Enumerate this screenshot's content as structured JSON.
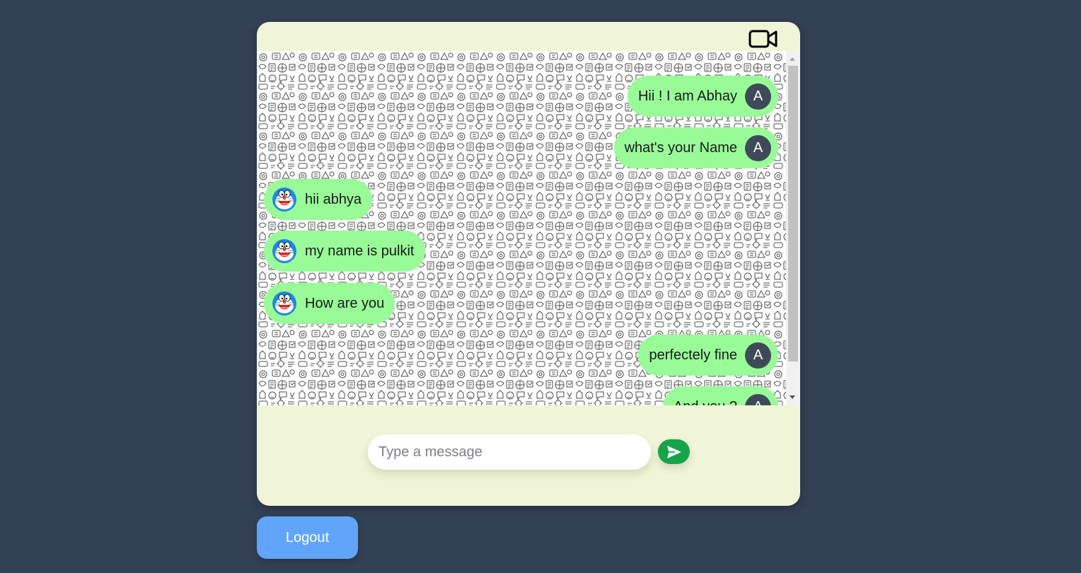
{
  "header": {
    "video_call_icon": "video-camera-icon"
  },
  "messages": [
    {
      "sender": "self",
      "avatar": "A",
      "text": "Hii ! I am Abhay"
    },
    {
      "sender": "self",
      "avatar": "A",
      "text": "what's your Name"
    },
    {
      "sender": "other",
      "avatar_icon": "doraemon-avatar-icon",
      "text": "hii abhya"
    },
    {
      "sender": "other",
      "avatar_icon": "doraemon-avatar-icon",
      "text": "my name is pulkit"
    },
    {
      "sender": "other",
      "avatar_icon": "doraemon-avatar-icon",
      "text": "How are you"
    },
    {
      "sender": "self",
      "avatar": "A",
      "text": "perfectely fine"
    },
    {
      "sender": "self",
      "avatar": "A",
      "text": "And you ?"
    }
  ],
  "composer": {
    "placeholder": "Type a message",
    "value": "",
    "send_icon": "send-paper-plane-icon"
  },
  "logout_label": "Logout",
  "colors": {
    "page_background": "#334155",
    "card_background": "#f0f5d7",
    "bubble": "#98fb98",
    "avatar": "#3f4a59",
    "send_button": "#16a34a",
    "logout_button": "#60a5fa"
  }
}
